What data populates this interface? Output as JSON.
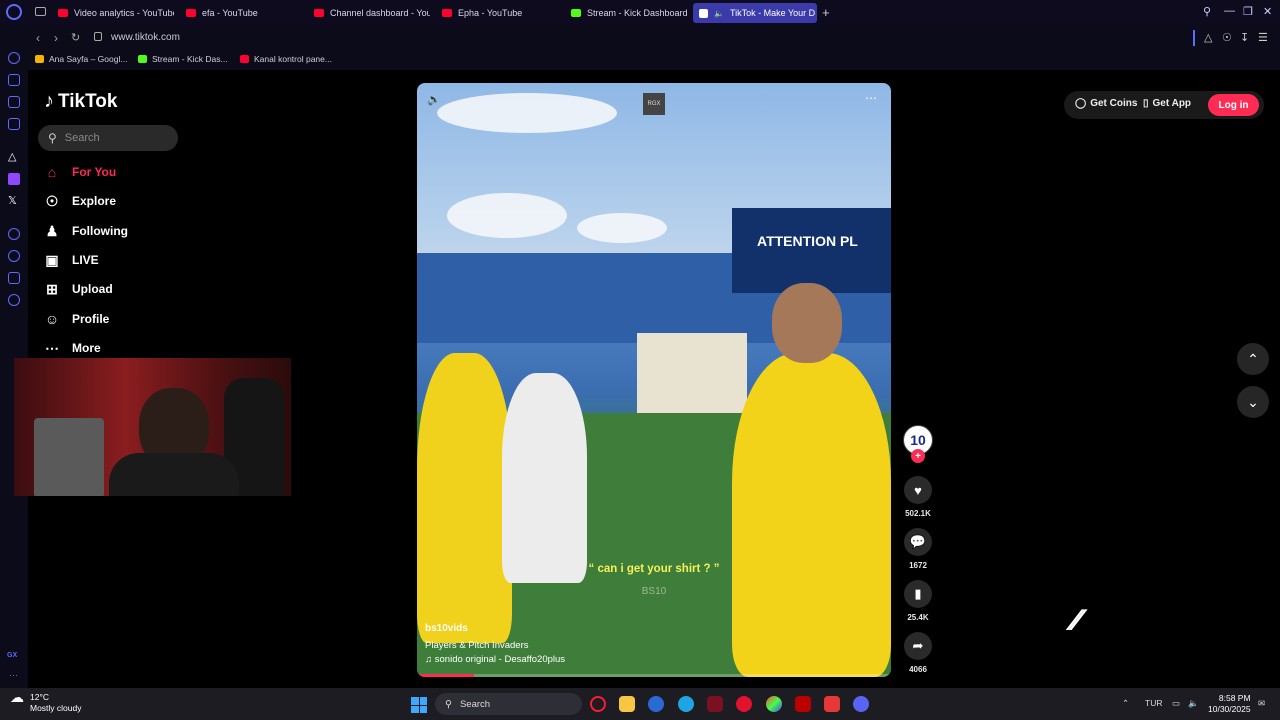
{
  "browser": {
    "tabs": [
      {
        "label": "Video analytics - YouTube",
        "favicon": "youtube-icon"
      },
      {
        "label": "efa - YouTube",
        "favicon": "youtube-icon"
      },
      {
        "label": "Channel dashboard - You",
        "favicon": "youtube-icon"
      },
      {
        "label": "Epha - YouTube",
        "favicon": "youtube-icon"
      },
      {
        "label": "Stream - Kick Dashboard",
        "favicon": "kick-icon"
      },
      {
        "label": "TikTok - Make Your D",
        "favicon": "tiktok-icon",
        "active": true
      }
    ],
    "url": "www.tiktok.com",
    "bookmarks": [
      {
        "label": "Ana Sayfa – Googl..."
      },
      {
        "label": "Stream - Kick Das..."
      },
      {
        "label": "Kanal kontrol pane..."
      }
    ]
  },
  "tiktok": {
    "logo_text": "TikTok",
    "search_placeholder": "Search",
    "nav": [
      {
        "label": "For You",
        "icon": "home-icon",
        "active": true
      },
      {
        "label": "Explore",
        "icon": "compass-icon"
      },
      {
        "label": "Following",
        "icon": "following-icon"
      },
      {
        "label": "LIVE",
        "icon": "live-icon"
      },
      {
        "label": "Upload",
        "icon": "upload-icon"
      },
      {
        "label": "Profile",
        "icon": "profile-icon"
      },
      {
        "label": "More",
        "icon": "more-icon"
      }
    ],
    "top_right": {
      "get_coins": "Get Coins",
      "get_app": "Get App",
      "login": "Log in"
    },
    "video": {
      "badge": "RGX",
      "caption": "“ can i get your shirt ? ”",
      "jersey_text": "BS10",
      "board_text": "ATTENTION PL",
      "username": "bs10vids",
      "description": "Players & Pitch Invaders",
      "music": "sonido original - Desaffo20plus",
      "progress": 0.12
    },
    "actions": {
      "avatar_text": "10",
      "likes": "502.1K",
      "comments": "1672",
      "saves": "25.4K",
      "shares": "4066"
    }
  },
  "taskbar": {
    "weather_temp": "12°C",
    "weather_desc": "Mostly cloudy",
    "search": "Search",
    "lang": "TUR",
    "time": "8:58 PM",
    "date": "10/30/2025"
  },
  "colors": {
    "accent": "#fe2c55",
    "opera": "#5b6cff"
  }
}
